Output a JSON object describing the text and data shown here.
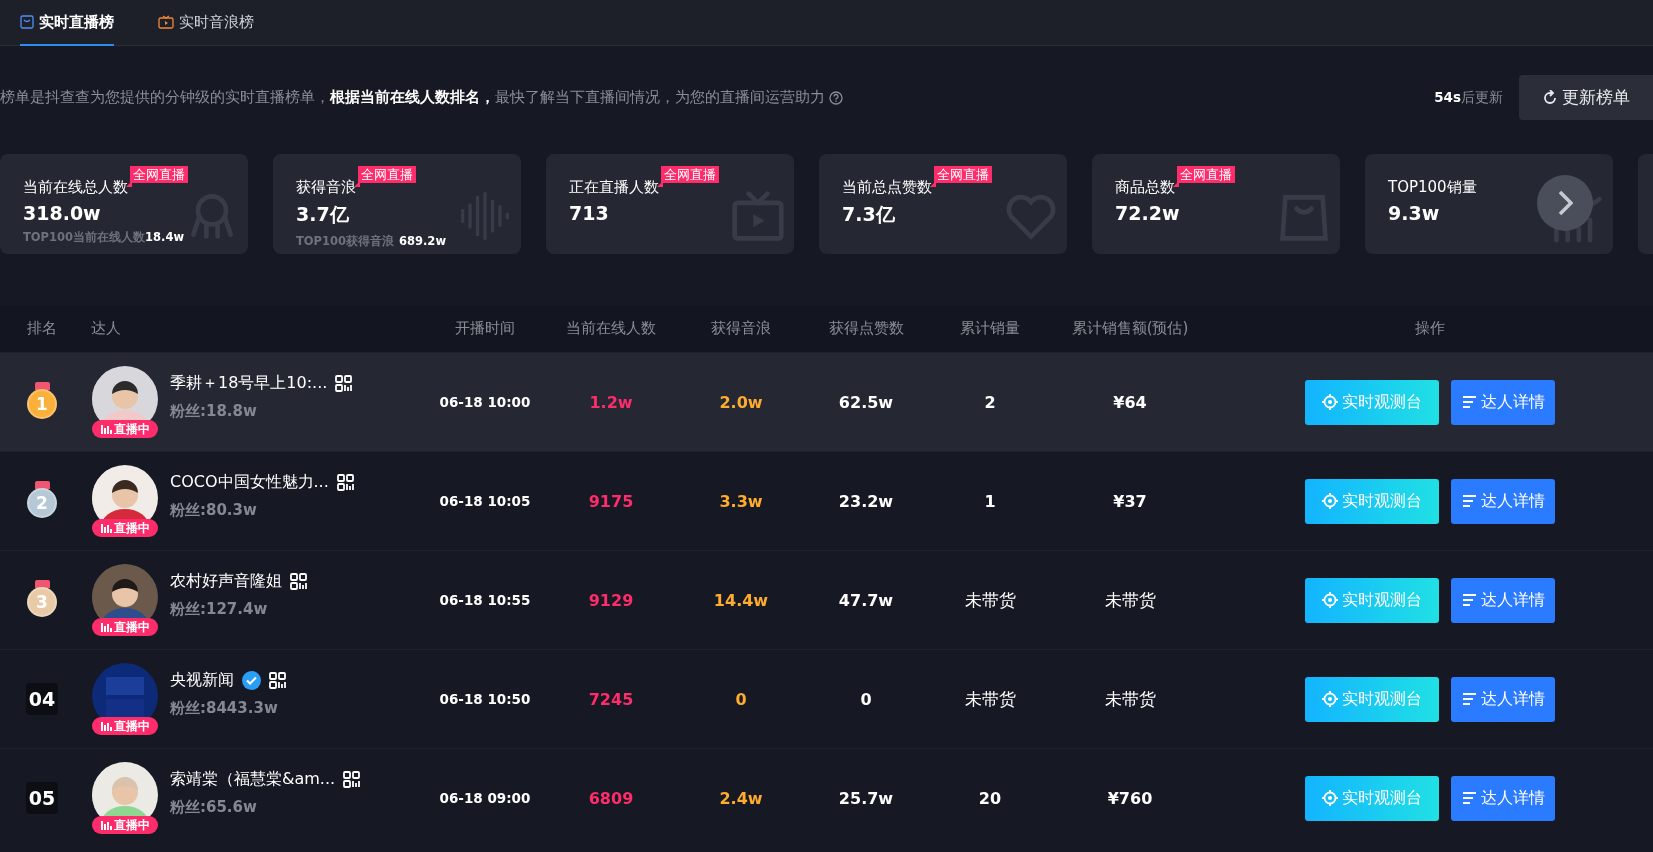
{
  "tabs": [
    {
      "label": "实时直播榜",
      "selected": true
    },
    {
      "label": "实时音浪榜",
      "selected": false
    }
  ],
  "notice": {
    "text": "榜单是抖查查为您提供的分钟级的实时直播榜单，**根据当前在线人数排名，**最快了解当下直播间情况，为您的直播间运营助力",
    "countdown": "54s",
    "countdown_suffix": "后更新",
    "refresh_button": "更新榜单"
  },
  "stat_cards": [
    {
      "title": "当前在线总人数",
      "badge": "全网直播",
      "value": "318.0w",
      "sub_label": "TOP100当前在线人数",
      "sub_value": "18.4w"
    },
    {
      "title": "获得音浪",
      "badge": "全网直播",
      "value": "3.7亿",
      "sub_label": "TOP100获得音浪",
      "sub_value": "689.2w"
    },
    {
      "title": "正在直播人数",
      "badge": "全网直播",
      "value": "713"
    },
    {
      "title": "当前总点赞数",
      "badge": "全网直播",
      "value": "7.3亿"
    },
    {
      "title": "商品总数",
      "badge": "全网直播",
      "value": "72.2w"
    },
    {
      "title": "TOP100销量",
      "value": "9.3w"
    }
  ],
  "table": {
    "columns": [
      "排名",
      "达人",
      "开播时间",
      "当前在线人数",
      "获得音浪",
      "获得点赞数",
      "累计销量",
      "累计销售额(预估)",
      "操作"
    ],
    "rows": [
      {
        "rank": "1",
        "kind": "medal",
        "color": "#fbb03b",
        "name": "季耕＋18号早上10:...",
        "live_badge": "直播中",
        "verified": false,
        "fans": "粉丝:18.8w",
        "start_time": "06-18 10:00",
        "online": "1.2w",
        "yinlang": "2.0w",
        "likes": "62.5w",
        "sales": {
          "text": "2",
          "carrying": true
        },
        "revenue": {
          "text": "¥64",
          "carrying": true
        },
        "buttons": [
          "实时观测台",
          "达人详情"
        ],
        "selected": true
      },
      {
        "rank": "2",
        "kind": "medal",
        "color": "#b6c8d6",
        "name": "COCO中国女性魅力...",
        "live_badge": "直播中",
        "verified": false,
        "fans": "粉丝:80.3w",
        "start_time": "06-18 10:05",
        "online": "9175",
        "yinlang": "3.3w",
        "likes": "23.2w",
        "sales": {
          "text": "1",
          "carrying": true
        },
        "revenue": {
          "text": "¥37",
          "carrying": true
        },
        "buttons": [
          "实时观测台",
          "达人详情"
        ],
        "selected": false
      },
      {
        "rank": "3",
        "kind": "medal",
        "color": "#e8cba6",
        "name": "农村好声音隆姐",
        "live_badge": "直播中",
        "verified": false,
        "fans": "粉丝:127.4w",
        "start_time": "06-18 10:55",
        "online": "9129",
        "yinlang": "14.4w",
        "likes": "47.7w",
        "sales": {
          "text": "未带货",
          "carrying": false
        },
        "revenue": {
          "text": "未带货",
          "carrying": false
        },
        "buttons": [
          "实时观测台",
          "达人详情"
        ],
        "selected": false
      },
      {
        "rank": "04",
        "kind": "plain",
        "name": "央视新闻",
        "live_badge": "直播中",
        "verified": true,
        "fans": "粉丝:8443.3w",
        "start_time": "06-18 10:50",
        "online": "7245",
        "yinlang": "0",
        "likes": "0",
        "sales": {
          "text": "未带货",
          "carrying": false
        },
        "revenue": {
          "text": "未带货",
          "carrying": false
        },
        "buttons": [
          "实时观测台",
          "达人详情"
        ],
        "selected": false
      },
      {
        "rank": "05",
        "kind": "plain",
        "name": "索靖棠（福慧棠&am...",
        "live_badge": "直播中",
        "verified": false,
        "fans": "粉丝:65.6w",
        "start_time": "06-18 09:00",
        "online": "6809",
        "yinlang": "2.4w",
        "likes": "25.7w",
        "sales": {
          "text": "20",
          "carrying": true
        },
        "revenue": {
          "text": "¥760",
          "carrying": true
        },
        "buttons": [
          "实时观测台",
          "达人详情"
        ],
        "selected": false
      }
    ]
  }
}
